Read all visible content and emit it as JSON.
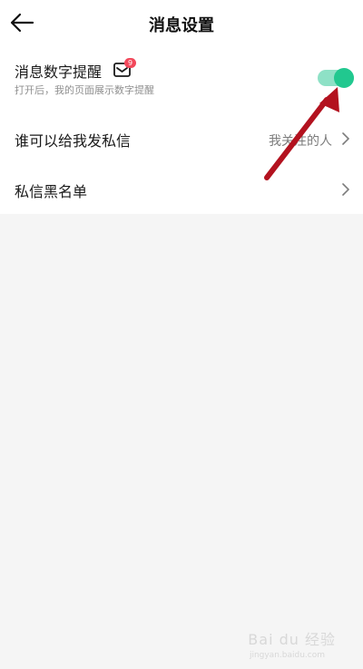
{
  "header": {
    "title": "消息设置",
    "back_icon": "arrow-left-icon"
  },
  "settings": {
    "number_reminder": {
      "label": "消息数字提醒",
      "description": "打开后，我的页面展示数字提醒",
      "badge_count": "9",
      "enabled": true,
      "toggle_color": "#21c88f"
    },
    "who_can_message": {
      "label": "谁可以给我发私信",
      "value": "我关注的人"
    },
    "blacklist": {
      "label": "私信黑名单"
    }
  },
  "watermark": {
    "text": "Bai du 经验",
    "sub": "jingyan.baidu.com"
  },
  "colors": {
    "accent": "#21c88f",
    "badge": "#f2485b",
    "annotation_arrow": "#b3121f"
  }
}
